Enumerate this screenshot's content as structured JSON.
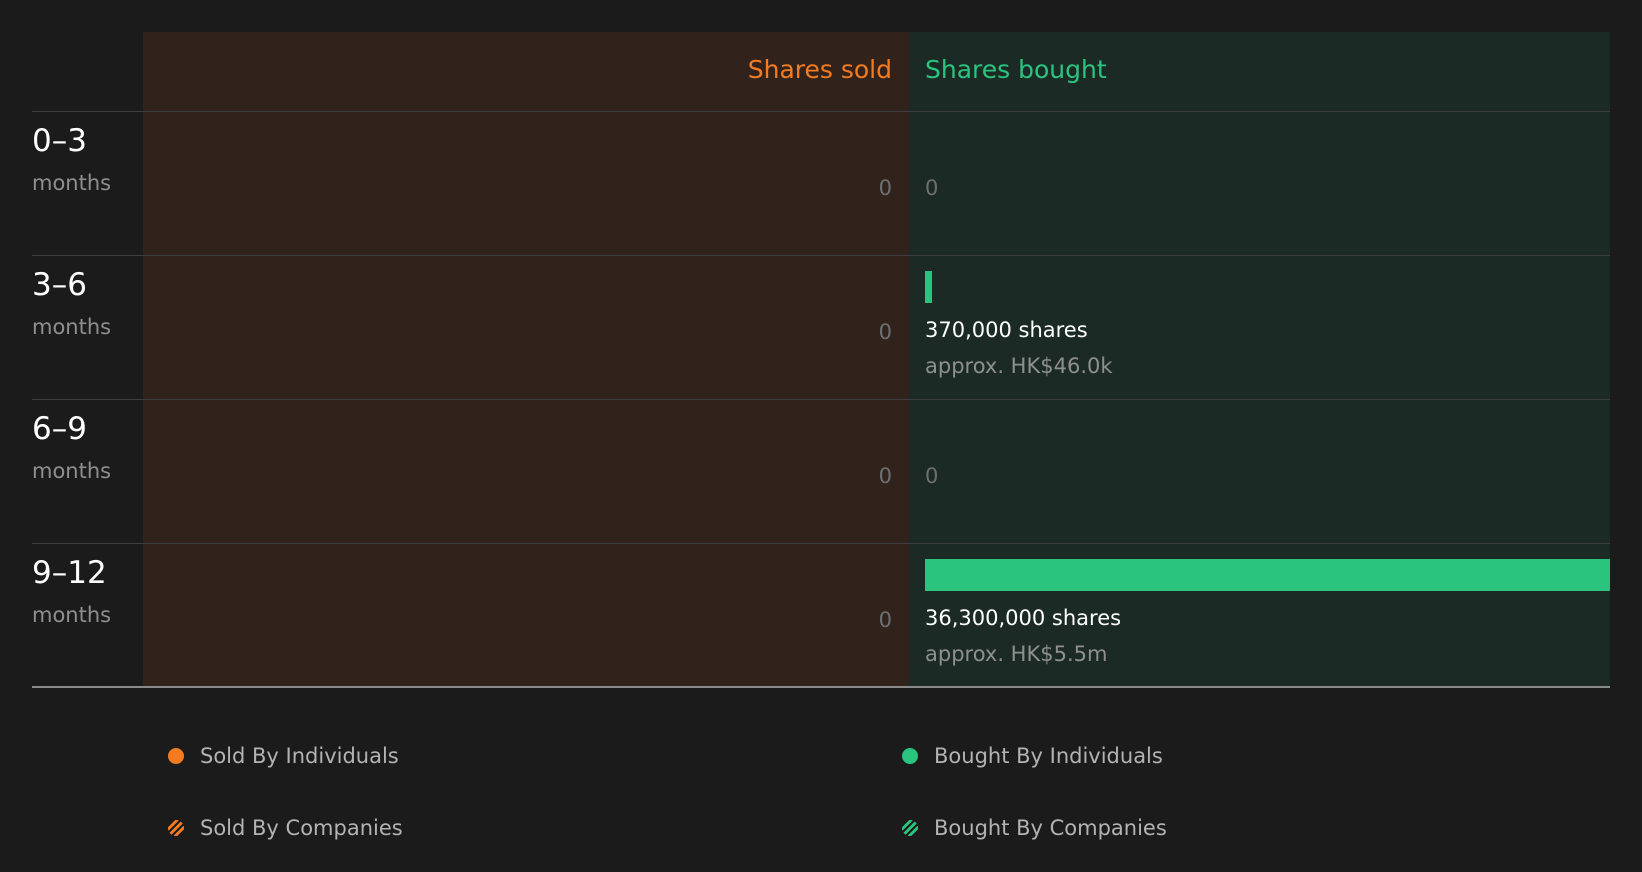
{
  "chart_data": {
    "type": "bar",
    "columns": {
      "sold_label": "Shares sold",
      "bought_label": "Shares bought"
    },
    "rows": [
      {
        "range": "0–3",
        "unit": "months",
        "sold": "0",
        "bought_shares": 0,
        "bought_label": "0",
        "bought_value": ""
      },
      {
        "range": "3–6",
        "unit": "months",
        "sold": "0",
        "bought_shares": 370000,
        "bought_label": "370,000 shares",
        "bought_value": "approx. HK$46.0k"
      },
      {
        "range": "6–9",
        "unit": "months",
        "sold": "0",
        "bought_shares": 0,
        "bought_label": "0",
        "bought_value": ""
      },
      {
        "range": "9–12",
        "unit": "months",
        "sold": "0",
        "bought_shares": 36300000,
        "bought_label": "36,300,000 shares",
        "bought_value": "approx. HK$5.5m"
      }
    ],
    "legend": [
      {
        "label": "Sold By Individuals",
        "color": "#f47b20",
        "style": "solid"
      },
      {
        "label": "Bought By Individuals",
        "color": "#2bc47f",
        "style": "solid"
      },
      {
        "label": "Sold By Companies",
        "color": "#f47b20",
        "style": "hatched"
      },
      {
        "label": "Bought By Companies",
        "color": "#2bc47f",
        "style": "hatched"
      }
    ],
    "colors": {
      "sold": "#f47b20",
      "bought": "#2bc47f"
    }
  }
}
